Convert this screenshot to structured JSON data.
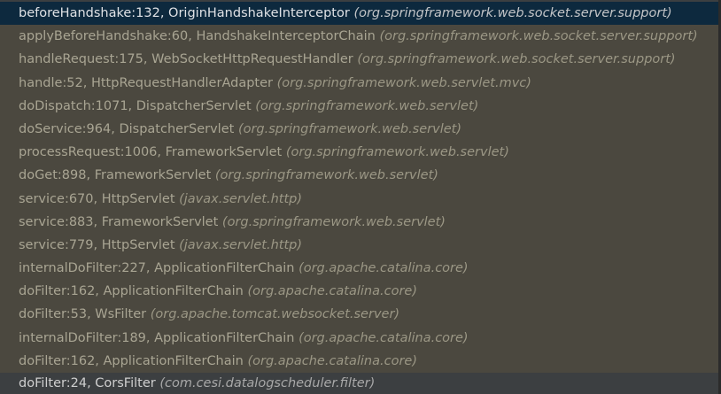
{
  "frames": [
    {
      "method": "beforeHandshake:132, OriginHandshakeInterceptor",
      "package": "(org.springframework.web.socket.server.support)"
    },
    {
      "method": "applyBeforeHandshake:60, HandshakeInterceptorChain",
      "package": "(org.springframework.web.socket.server.support)"
    },
    {
      "method": "handleRequest:175, WebSocketHttpRequestHandler",
      "package": "(org.springframework.web.socket.server.support)"
    },
    {
      "method": "handle:52, HttpRequestHandlerAdapter",
      "package": "(org.springframework.web.servlet.mvc)"
    },
    {
      "method": "doDispatch:1071, DispatcherServlet",
      "package": "(org.springframework.web.servlet)"
    },
    {
      "method": "doService:964, DispatcherServlet",
      "package": "(org.springframework.web.servlet)"
    },
    {
      "method": "processRequest:1006, FrameworkServlet",
      "package": "(org.springframework.web.servlet)"
    },
    {
      "method": "doGet:898, FrameworkServlet",
      "package": "(org.springframework.web.servlet)"
    },
    {
      "method": "service:670, HttpServlet",
      "package": "(javax.servlet.http)"
    },
    {
      "method": "service:883, FrameworkServlet",
      "package": "(org.springframework.web.servlet)"
    },
    {
      "method": "service:779, HttpServlet",
      "package": "(javax.servlet.http)"
    },
    {
      "method": "internalDoFilter:227, ApplicationFilterChain",
      "package": "(org.apache.catalina.core)"
    },
    {
      "method": "doFilter:162, ApplicationFilterChain",
      "package": "(org.apache.catalina.core)"
    },
    {
      "method": "doFilter:53, WsFilter",
      "package": "(org.apache.tomcat.websocket.server)"
    },
    {
      "method": "internalDoFilter:189, ApplicationFilterChain",
      "package": "(org.apache.catalina.core)"
    },
    {
      "method": "doFilter:162, ApplicationFilterChain",
      "package": "(org.apache.catalina.core)"
    },
    {
      "method": "doFilter:24, CorsFilter",
      "package": "(com.cesi.datalogscheduler.filter)"
    }
  ],
  "colors": {
    "selected_background": "#0d293e",
    "list_background": "#4b483f",
    "panel_background": "#3c3f41"
  }
}
